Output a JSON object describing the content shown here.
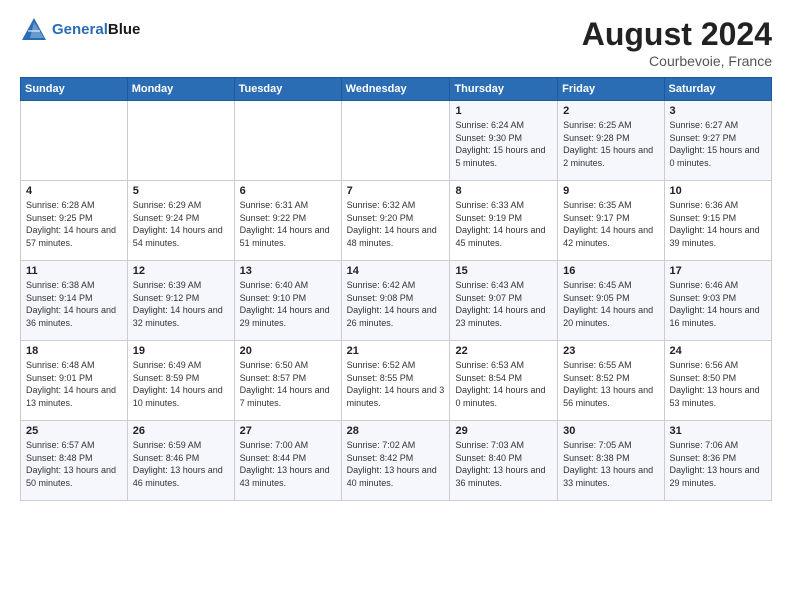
{
  "header": {
    "logo_line1": "General",
    "logo_line2": "Blue",
    "month_year": "August 2024",
    "location": "Courbevoie, France"
  },
  "days_of_week": [
    "Sunday",
    "Monday",
    "Tuesday",
    "Wednesday",
    "Thursday",
    "Friday",
    "Saturday"
  ],
  "weeks": [
    [
      {
        "day": "",
        "sunrise": "",
        "sunset": "",
        "daylight": ""
      },
      {
        "day": "",
        "sunrise": "",
        "sunset": "",
        "daylight": ""
      },
      {
        "day": "",
        "sunrise": "",
        "sunset": "",
        "daylight": ""
      },
      {
        "day": "",
        "sunrise": "",
        "sunset": "",
        "daylight": ""
      },
      {
        "day": "1",
        "sunrise": "Sunrise: 6:24 AM",
        "sunset": "Sunset: 9:30 PM",
        "daylight": "Daylight: 15 hours and 5 minutes."
      },
      {
        "day": "2",
        "sunrise": "Sunrise: 6:25 AM",
        "sunset": "Sunset: 9:28 PM",
        "daylight": "Daylight: 15 hours and 2 minutes."
      },
      {
        "day": "3",
        "sunrise": "Sunrise: 6:27 AM",
        "sunset": "Sunset: 9:27 PM",
        "daylight": "Daylight: 15 hours and 0 minutes."
      }
    ],
    [
      {
        "day": "4",
        "sunrise": "Sunrise: 6:28 AM",
        "sunset": "Sunset: 9:25 PM",
        "daylight": "Daylight: 14 hours and 57 minutes."
      },
      {
        "day": "5",
        "sunrise": "Sunrise: 6:29 AM",
        "sunset": "Sunset: 9:24 PM",
        "daylight": "Daylight: 14 hours and 54 minutes."
      },
      {
        "day": "6",
        "sunrise": "Sunrise: 6:31 AM",
        "sunset": "Sunset: 9:22 PM",
        "daylight": "Daylight: 14 hours and 51 minutes."
      },
      {
        "day": "7",
        "sunrise": "Sunrise: 6:32 AM",
        "sunset": "Sunset: 9:20 PM",
        "daylight": "Daylight: 14 hours and 48 minutes."
      },
      {
        "day": "8",
        "sunrise": "Sunrise: 6:33 AM",
        "sunset": "Sunset: 9:19 PM",
        "daylight": "Daylight: 14 hours and 45 minutes."
      },
      {
        "day": "9",
        "sunrise": "Sunrise: 6:35 AM",
        "sunset": "Sunset: 9:17 PM",
        "daylight": "Daylight: 14 hours and 42 minutes."
      },
      {
        "day": "10",
        "sunrise": "Sunrise: 6:36 AM",
        "sunset": "Sunset: 9:15 PM",
        "daylight": "Daylight: 14 hours and 39 minutes."
      }
    ],
    [
      {
        "day": "11",
        "sunrise": "Sunrise: 6:38 AM",
        "sunset": "Sunset: 9:14 PM",
        "daylight": "Daylight: 14 hours and 36 minutes."
      },
      {
        "day": "12",
        "sunrise": "Sunrise: 6:39 AM",
        "sunset": "Sunset: 9:12 PM",
        "daylight": "Daylight: 14 hours and 32 minutes."
      },
      {
        "day": "13",
        "sunrise": "Sunrise: 6:40 AM",
        "sunset": "Sunset: 9:10 PM",
        "daylight": "Daylight: 14 hours and 29 minutes."
      },
      {
        "day": "14",
        "sunrise": "Sunrise: 6:42 AM",
        "sunset": "Sunset: 9:08 PM",
        "daylight": "Daylight: 14 hours and 26 minutes."
      },
      {
        "day": "15",
        "sunrise": "Sunrise: 6:43 AM",
        "sunset": "Sunset: 9:07 PM",
        "daylight": "Daylight: 14 hours and 23 minutes."
      },
      {
        "day": "16",
        "sunrise": "Sunrise: 6:45 AM",
        "sunset": "Sunset: 9:05 PM",
        "daylight": "Daylight: 14 hours and 20 minutes."
      },
      {
        "day": "17",
        "sunrise": "Sunrise: 6:46 AM",
        "sunset": "Sunset: 9:03 PM",
        "daylight": "Daylight: 14 hours and 16 minutes."
      }
    ],
    [
      {
        "day": "18",
        "sunrise": "Sunrise: 6:48 AM",
        "sunset": "Sunset: 9:01 PM",
        "daylight": "Daylight: 14 hours and 13 minutes."
      },
      {
        "day": "19",
        "sunrise": "Sunrise: 6:49 AM",
        "sunset": "Sunset: 8:59 PM",
        "daylight": "Daylight: 14 hours and 10 minutes."
      },
      {
        "day": "20",
        "sunrise": "Sunrise: 6:50 AM",
        "sunset": "Sunset: 8:57 PM",
        "daylight": "Daylight: 14 hours and 7 minutes."
      },
      {
        "day": "21",
        "sunrise": "Sunrise: 6:52 AM",
        "sunset": "Sunset: 8:55 PM",
        "daylight": "Daylight: 14 hours and 3 minutes."
      },
      {
        "day": "22",
        "sunrise": "Sunrise: 6:53 AM",
        "sunset": "Sunset: 8:54 PM",
        "daylight": "Daylight: 14 hours and 0 minutes."
      },
      {
        "day": "23",
        "sunrise": "Sunrise: 6:55 AM",
        "sunset": "Sunset: 8:52 PM",
        "daylight": "Daylight: 13 hours and 56 minutes."
      },
      {
        "day": "24",
        "sunrise": "Sunrise: 6:56 AM",
        "sunset": "Sunset: 8:50 PM",
        "daylight": "Daylight: 13 hours and 53 minutes."
      }
    ],
    [
      {
        "day": "25",
        "sunrise": "Sunrise: 6:57 AM",
        "sunset": "Sunset: 8:48 PM",
        "daylight": "Daylight: 13 hours and 50 minutes."
      },
      {
        "day": "26",
        "sunrise": "Sunrise: 6:59 AM",
        "sunset": "Sunset: 8:46 PM",
        "daylight": "Daylight: 13 hours and 46 minutes."
      },
      {
        "day": "27",
        "sunrise": "Sunrise: 7:00 AM",
        "sunset": "Sunset: 8:44 PM",
        "daylight": "Daylight: 13 hours and 43 minutes."
      },
      {
        "day": "28",
        "sunrise": "Sunrise: 7:02 AM",
        "sunset": "Sunset: 8:42 PM",
        "daylight": "Daylight: 13 hours and 40 minutes."
      },
      {
        "day": "29",
        "sunrise": "Sunrise: 7:03 AM",
        "sunset": "Sunset: 8:40 PM",
        "daylight": "Daylight: 13 hours and 36 minutes."
      },
      {
        "day": "30",
        "sunrise": "Sunrise: 7:05 AM",
        "sunset": "Sunset: 8:38 PM",
        "daylight": "Daylight: 13 hours and 33 minutes."
      },
      {
        "day": "31",
        "sunrise": "Sunrise: 7:06 AM",
        "sunset": "Sunset: 8:36 PM",
        "daylight": "Daylight: 13 hours and 29 minutes."
      }
    ]
  ]
}
